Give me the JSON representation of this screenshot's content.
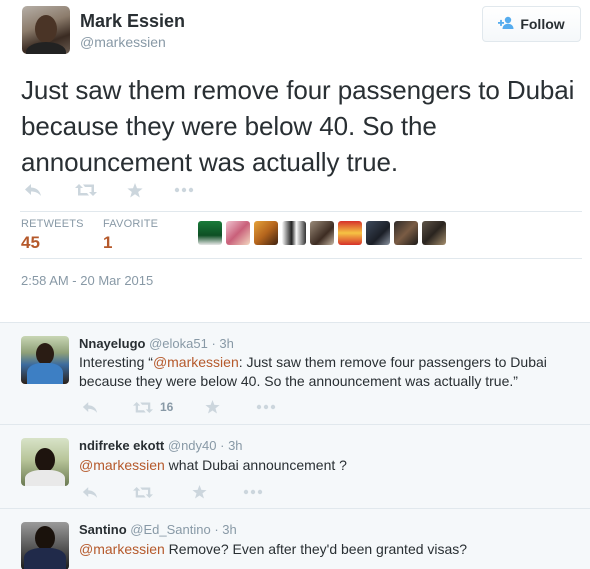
{
  "tweet": {
    "author_name": "Mark Essien",
    "author_handle": "@markessien",
    "follow_label": "Follow",
    "text": "Just saw them remove four passengers to Dubai because they were below 40. So the announcement was actually true.",
    "stats": {
      "retweets_label": "RETWEETS",
      "retweets_value": "45",
      "favorites_label": "FAVORITE",
      "favorites_value": "1"
    },
    "timestamp": "2:58 AM - 20 Mar 2015",
    "action_icons": [
      "reply-icon",
      "retweet-icon",
      "favorite-star-icon",
      "more-dots-icon"
    ],
    "favoriter_avatars": 9
  },
  "replies": [
    {
      "name": "Nnayelugo",
      "handle": "@eloka51",
      "time": "· 3h",
      "text_prefix": "Interesting “",
      "mention": "@markessien",
      "text_rest": ": Just saw them remove four passengers to Dubai because they were below 40. So the announcement was actually true.”",
      "retweet_count": "16"
    },
    {
      "name": "ndifreke ekott",
      "handle": "@ndy40",
      "time": "· 3h",
      "mention": "@markessien",
      "text_rest": " what Dubai announcement ?"
    },
    {
      "name": "Santino",
      "handle": "@Ed_Santino",
      "time": "· 3h",
      "mention": "@markessien",
      "text_rest": " Remove? Even after they'd been granted visas?"
    }
  ],
  "colors": {
    "accent_link": "#b5592b",
    "follow_icon": "#55acee",
    "muted_text": "#8899a6",
    "icon_gray": "#ccd6dd"
  }
}
